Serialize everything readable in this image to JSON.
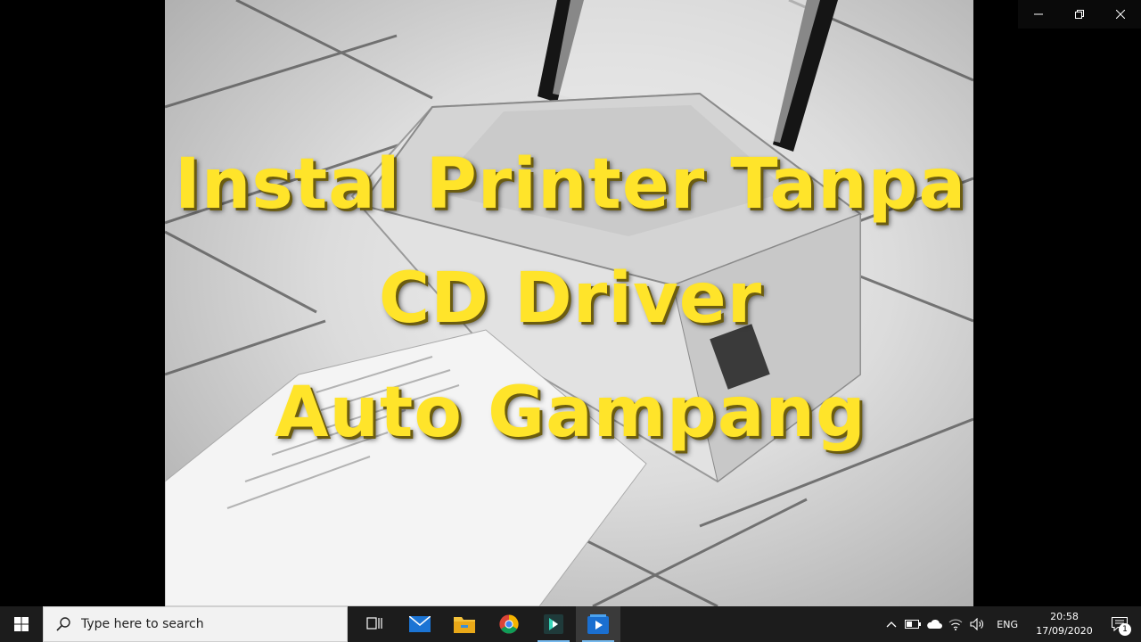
{
  "window_controls": {
    "minimize_icon": "minimize-icon",
    "restore_icon": "restore-icon",
    "close_icon": "close-icon"
  },
  "video": {
    "title_lines": [
      "Instal Printer Tanpa",
      "CD Driver",
      "Auto Gampang"
    ],
    "text_color": "#ffe42a"
  },
  "taskbar": {
    "start_icon": "windows-logo-icon",
    "search": {
      "placeholder": "Type here to search",
      "value": ""
    },
    "apps": [
      {
        "name": "task-view-icon"
      },
      {
        "name": "mail-icon"
      },
      {
        "name": "file-explorer-icon"
      },
      {
        "name": "chrome-icon"
      },
      {
        "name": "filmora-icon"
      },
      {
        "name": "video-editor-icon"
      }
    ],
    "tray": {
      "language": "ENG",
      "time": "20:58",
      "date": "17/09/2020",
      "notification_count": "1"
    }
  }
}
